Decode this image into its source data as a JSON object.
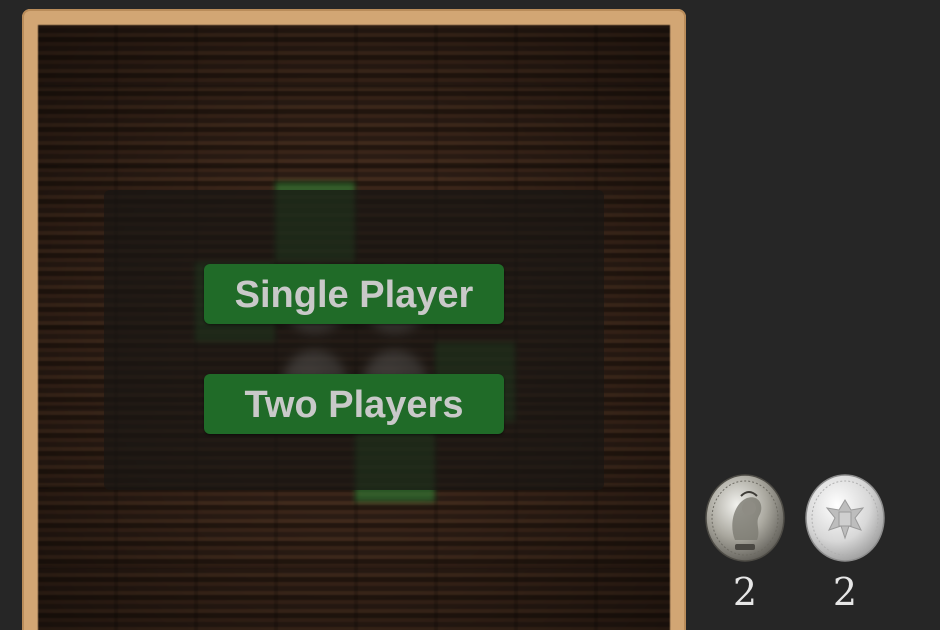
{
  "menu": {
    "single_player_label": "Single Player",
    "two_players_label": "Two Players"
  },
  "scores": [
    {
      "coin": "draped-bust-silver-coin-icon",
      "count": "2"
    },
    {
      "coin": "silver-eagle-coin-icon",
      "count": "2"
    }
  ],
  "colors": {
    "background": "#262626",
    "frame": "#d2a674",
    "board": "#2e1e15",
    "button": "#206b28",
    "button_text": "#c9c9c9",
    "highlight_cell": "#2f8a38"
  }
}
